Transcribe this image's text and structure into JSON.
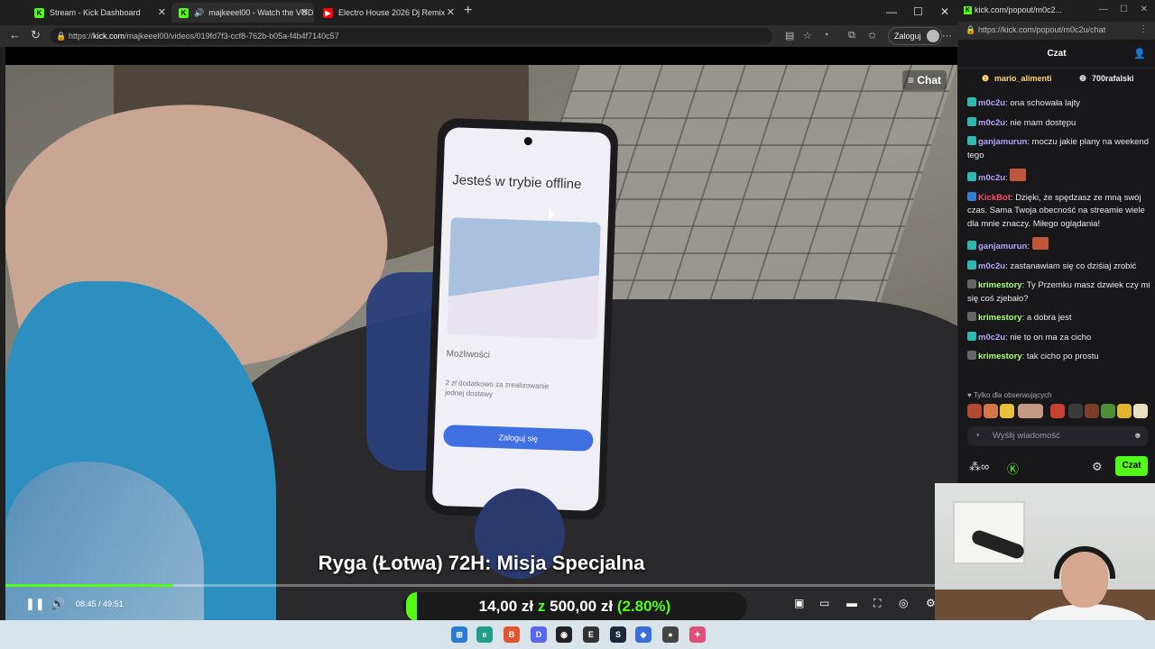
{
  "browser": {
    "tabs": [
      {
        "label": "Stream - Kick Dashboard"
      },
      {
        "label": "majkeeel00 - Watch the VOD"
      },
      {
        "label": "Electro House 2026 Dj Remix"
      }
    ],
    "url_prefix": "https://",
    "url_domain": "kick.com",
    "url_path": "/majkeeel00/videos/019fd7f3-ccf8-762b-b05a-f4b4f7140c57",
    "login_label": "Zaloguj"
  },
  "video": {
    "chat_button": "Chat",
    "phone": {
      "heading": "Jesteś w trybie offline",
      "section": "Możliwości",
      "line": "2 zł dodatkowo za zrealizowanie jednej dostawy",
      "button": "Zaloguj się"
    },
    "title": "Ryga (Łotwa) 72H: Misja Specjalna",
    "time_current": "08:45",
    "time_total": "49:51",
    "progress_fraction": 0.176,
    "donation": {
      "current": "14,00 zł",
      "sep": "z",
      "goal": "500,00 zł",
      "percent": "(2.80%)"
    }
  },
  "chat_window": {
    "title": "kick.com/popout/m0c2...",
    "url": "https://kick.com/popout/m0c2u/chat",
    "header": "Czat",
    "gifters": [
      "mario_alimenti",
      "700rafalski"
    ],
    "messages": [
      {
        "user": "m0c2u",
        "color": "#b7a3ff",
        "text": "ona schowała lajty"
      },
      {
        "user": "m0c2u",
        "color": "#b7a3ff",
        "text": "nie mam dostępu"
      },
      {
        "user": "ganjamurun",
        "color": "#b7a3ff",
        "text": "moczu jakie plany na weekend tego"
      },
      {
        "user": "m0c2u",
        "color": "#b7a3ff",
        "text": ""
      },
      {
        "user": "KickBot",
        "color": "#ff4d67",
        "text": "Dzięki, że spędzasz ze mną swój czas. Sama Twoja obecność na streamie wiele dla mnie znaczy. Miłego oglądania!"
      },
      {
        "user": "ganjamurun",
        "color": "#b7a3ff",
        "text": ""
      },
      {
        "user": "m0c2u",
        "color": "#b7a3ff",
        "text": "zastanawiam się co dziśiaj zrobić"
      },
      {
        "user": "krimestory",
        "color": "#a8ff7a",
        "text": "Ty Przemku masz dzwiek czy mi się coś zjebało?"
      },
      {
        "user": "krimestory",
        "color": "#a8ff7a",
        "text": "a dobra jest"
      },
      {
        "user": "m0c2u",
        "color": "#b7a3ff",
        "text": "nie to on ma za cicho"
      },
      {
        "user": "krimestory",
        "color": "#a8ff7a",
        "text": "tak cicho po prostu"
      }
    ],
    "followers_only": "Tylko dla obserwujących",
    "input_placeholder": "Wyślij wiadomość",
    "send_label": "Czat"
  },
  "colors": {
    "kick_green": "#53fc18",
    "chat_bg": "#18181b"
  }
}
